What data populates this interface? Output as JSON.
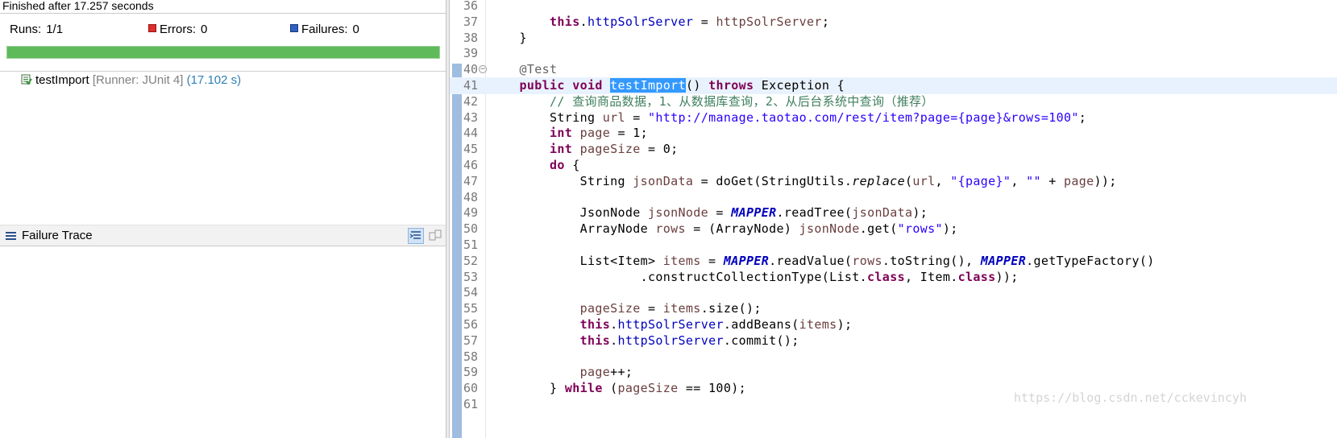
{
  "junit": {
    "finished_text": "Finished after 17.257 seconds",
    "runs_label": "Runs:",
    "runs_value": "1/1",
    "errors_label": "Errors:",
    "errors_value": "0",
    "failures_label": "Failures:",
    "failures_value": "0",
    "progress_fraction": 1.0,
    "progress_color": "#5fba5a",
    "test": {
      "name": "testImport",
      "runner": "[Runner: JUnit 4]",
      "time": "(17.102 s)"
    },
    "failure_trace_title": "Failure Trace"
  },
  "editor": {
    "lines": [
      {
        "n": "36",
        "tokens": []
      },
      {
        "n": "37",
        "tokens": [
          {
            "t": "        "
          },
          {
            "t": "this",
            "c": "kw"
          },
          {
            "t": "."
          },
          {
            "t": "httpSolrServer",
            "c": "fld"
          },
          {
            "t": " = "
          },
          {
            "t": "httpSolrServer",
            "c": "var"
          },
          {
            "t": ";"
          }
        ]
      },
      {
        "n": "38",
        "tokens": [
          {
            "t": "    }"
          }
        ]
      },
      {
        "n": "39",
        "tokens": []
      },
      {
        "n": "40",
        "fold": true,
        "tokens": [
          {
            "t": "    "
          },
          {
            "t": "@Test",
            "c": "ann"
          }
        ]
      },
      {
        "n": "41",
        "current": true,
        "tokens": [
          {
            "t": "    "
          },
          {
            "t": "public",
            "c": "kw"
          },
          {
            "t": " "
          },
          {
            "t": "void",
            "c": "kw"
          },
          {
            "t": " "
          },
          {
            "t": "testImport",
            "c": "sel"
          },
          {
            "t": "() "
          },
          {
            "t": "throws",
            "c": "kw"
          },
          {
            "t": " Exception {"
          }
        ]
      },
      {
        "n": "42",
        "tokens": [
          {
            "t": "        "
          },
          {
            "t": "// 查询商品数据，1、从数据库查询，2、从后台系统中查询（推荐）",
            "c": "cmt"
          }
        ]
      },
      {
        "n": "43",
        "tokens": [
          {
            "t": "        String "
          },
          {
            "t": "url",
            "c": "var"
          },
          {
            "t": " = "
          },
          {
            "t": "\"http://manage.taotao.com/rest/item?page={page}&rows=100\"",
            "c": "str"
          },
          {
            "t": ";"
          }
        ]
      },
      {
        "n": "44",
        "tokens": [
          {
            "t": "        "
          },
          {
            "t": "int",
            "c": "kw"
          },
          {
            "t": " "
          },
          {
            "t": "page",
            "c": "var"
          },
          {
            "t": " = 1;"
          }
        ]
      },
      {
        "n": "45",
        "tokens": [
          {
            "t": "        "
          },
          {
            "t": "int",
            "c": "kw"
          },
          {
            "t": " "
          },
          {
            "t": "pageSize",
            "c": "var"
          },
          {
            "t": " = 0;"
          }
        ]
      },
      {
        "n": "46",
        "tokens": [
          {
            "t": "        "
          },
          {
            "t": "do",
            "c": "kw"
          },
          {
            "t": " {"
          }
        ]
      },
      {
        "n": "47",
        "tokens": [
          {
            "t": "            String "
          },
          {
            "t": "jsonData",
            "c": "var"
          },
          {
            "t": " = doGet(StringUtils."
          },
          {
            "t": "replace",
            "c": "it"
          },
          {
            "t": "("
          },
          {
            "t": "url",
            "c": "var"
          },
          {
            "t": ", "
          },
          {
            "t": "\"{page}\"",
            "c": "str"
          },
          {
            "t": ", "
          },
          {
            "t": "\"\"",
            "c": "str"
          },
          {
            "t": " + "
          },
          {
            "t": "page",
            "c": "var"
          },
          {
            "t": "));"
          }
        ]
      },
      {
        "n": "48",
        "tokens": []
      },
      {
        "n": "49",
        "tokens": [
          {
            "t": "            JsonNode "
          },
          {
            "t": "jsonNode",
            "c": "var"
          },
          {
            "t": " = "
          },
          {
            "t": "MAPPER",
            "c": "sf"
          },
          {
            "t": ".readTree("
          },
          {
            "t": "jsonData",
            "c": "var"
          },
          {
            "t": ");"
          }
        ]
      },
      {
        "n": "50",
        "tokens": [
          {
            "t": "            ArrayNode "
          },
          {
            "t": "rows",
            "c": "var"
          },
          {
            "t": " = (ArrayNode) "
          },
          {
            "t": "jsonNode",
            "c": "var"
          },
          {
            "t": ".get("
          },
          {
            "t": "\"rows\"",
            "c": "str"
          },
          {
            "t": ");"
          }
        ]
      },
      {
        "n": "51",
        "tokens": []
      },
      {
        "n": "52",
        "tokens": [
          {
            "t": "            List<Item> "
          },
          {
            "t": "items",
            "c": "var"
          },
          {
            "t": " = "
          },
          {
            "t": "MAPPER",
            "c": "sf"
          },
          {
            "t": ".readValue("
          },
          {
            "t": "rows",
            "c": "var"
          },
          {
            "t": ".toString(), "
          },
          {
            "t": "MAPPER",
            "c": "sf"
          },
          {
            "t": ".getTypeFactory()"
          }
        ]
      },
      {
        "n": "53",
        "tokens": [
          {
            "t": "                    .constructCollectionType(List."
          },
          {
            "t": "class",
            "c": "kw"
          },
          {
            "t": ", Item."
          },
          {
            "t": "class",
            "c": "kw"
          },
          {
            "t": "));"
          }
        ]
      },
      {
        "n": "54",
        "tokens": []
      },
      {
        "n": "55",
        "tokens": [
          {
            "t": "            "
          },
          {
            "t": "pageSize",
            "c": "var"
          },
          {
            "t": " = "
          },
          {
            "t": "items",
            "c": "var"
          },
          {
            "t": ".size();"
          }
        ]
      },
      {
        "n": "56",
        "tokens": [
          {
            "t": "            "
          },
          {
            "t": "this",
            "c": "kw"
          },
          {
            "t": "."
          },
          {
            "t": "httpSolrServer",
            "c": "fld"
          },
          {
            "t": ".addBeans("
          },
          {
            "t": "items",
            "c": "var"
          },
          {
            "t": ");"
          }
        ]
      },
      {
        "n": "57",
        "tokens": [
          {
            "t": "            "
          },
          {
            "t": "this",
            "c": "kw"
          },
          {
            "t": "."
          },
          {
            "t": "httpSolrServer",
            "c": "fld"
          },
          {
            "t": ".commit();"
          }
        ]
      },
      {
        "n": "58",
        "tokens": []
      },
      {
        "n": "59",
        "tokens": [
          {
            "t": "            "
          },
          {
            "t": "page",
            "c": "var"
          },
          {
            "t": "++;"
          }
        ]
      },
      {
        "n": "60",
        "tokens": [
          {
            "t": "        } "
          },
          {
            "t": "while",
            "c": "kw"
          },
          {
            "t": " ("
          },
          {
            "t": "pageSize",
            "c": "var"
          },
          {
            "t": " == 100);"
          }
        ]
      },
      {
        "n": "61",
        "tokens": []
      }
    ]
  },
  "watermark": "https://blog.csdn.net/cckevincyh",
  "colors": {
    "keyword": "#7f0055",
    "field": "#0000c0",
    "string": "#2a00ff",
    "comment": "#3f7f5f",
    "local_var": "#6a3e3e",
    "selection": "#3399ff",
    "current_line": "#e8f2fe"
  }
}
